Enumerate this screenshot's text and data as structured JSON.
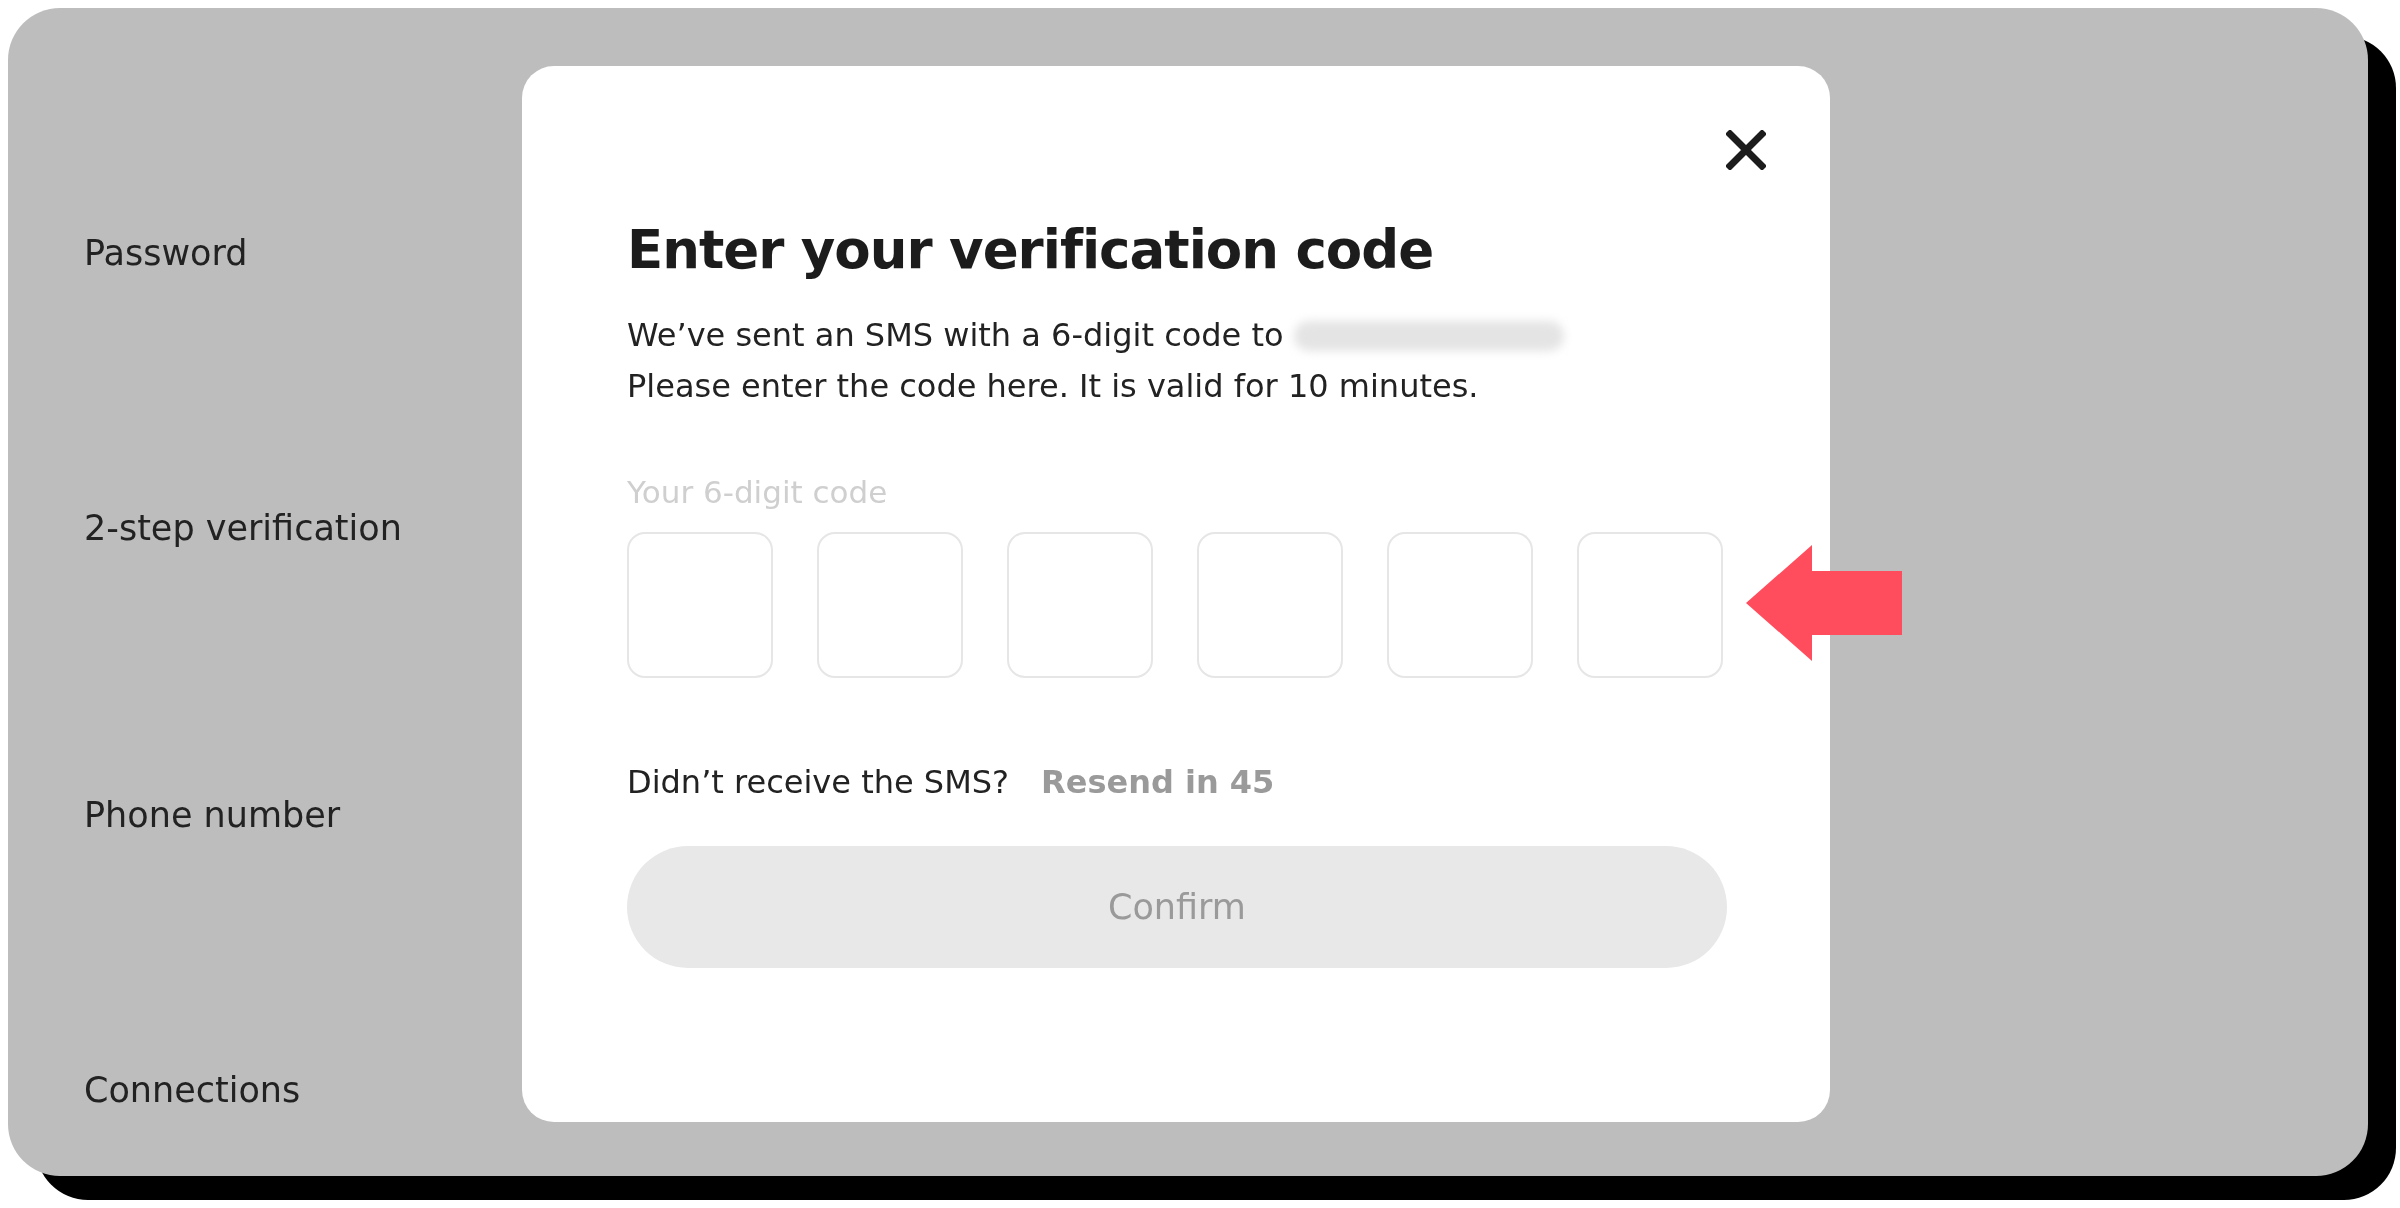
{
  "settings": {
    "labels": [
      "Password",
      "2-step verification",
      "Phone number",
      "Connections"
    ]
  },
  "dialog": {
    "title": "Enter your verification code",
    "message": [
      "We’ve sent an SMS with a 6-digit code to",
      "Please enter the code here. It is valid for 10 minutes."
    ],
    "phone_redacted": true,
    "code_label": "Your 6-digit code",
    "code_boxes": [
      {
        "filled": false
      },
      {
        "filled": false
      },
      {
        "filled": false
      },
      {
        "filled": false
      },
      {
        "filled": false
      },
      {
        "filled": false
      }
    ],
    "resend_prompt": "Didn’t receive the SMS?",
    "resend": {
      "text": "Resend in 45",
      "disabled": true
    },
    "confirm": {
      "text": "Confirm",
      "disabled": true
    }
  },
  "annotation": {
    "kind": "arrow",
    "color": "#ff4d5e"
  }
}
